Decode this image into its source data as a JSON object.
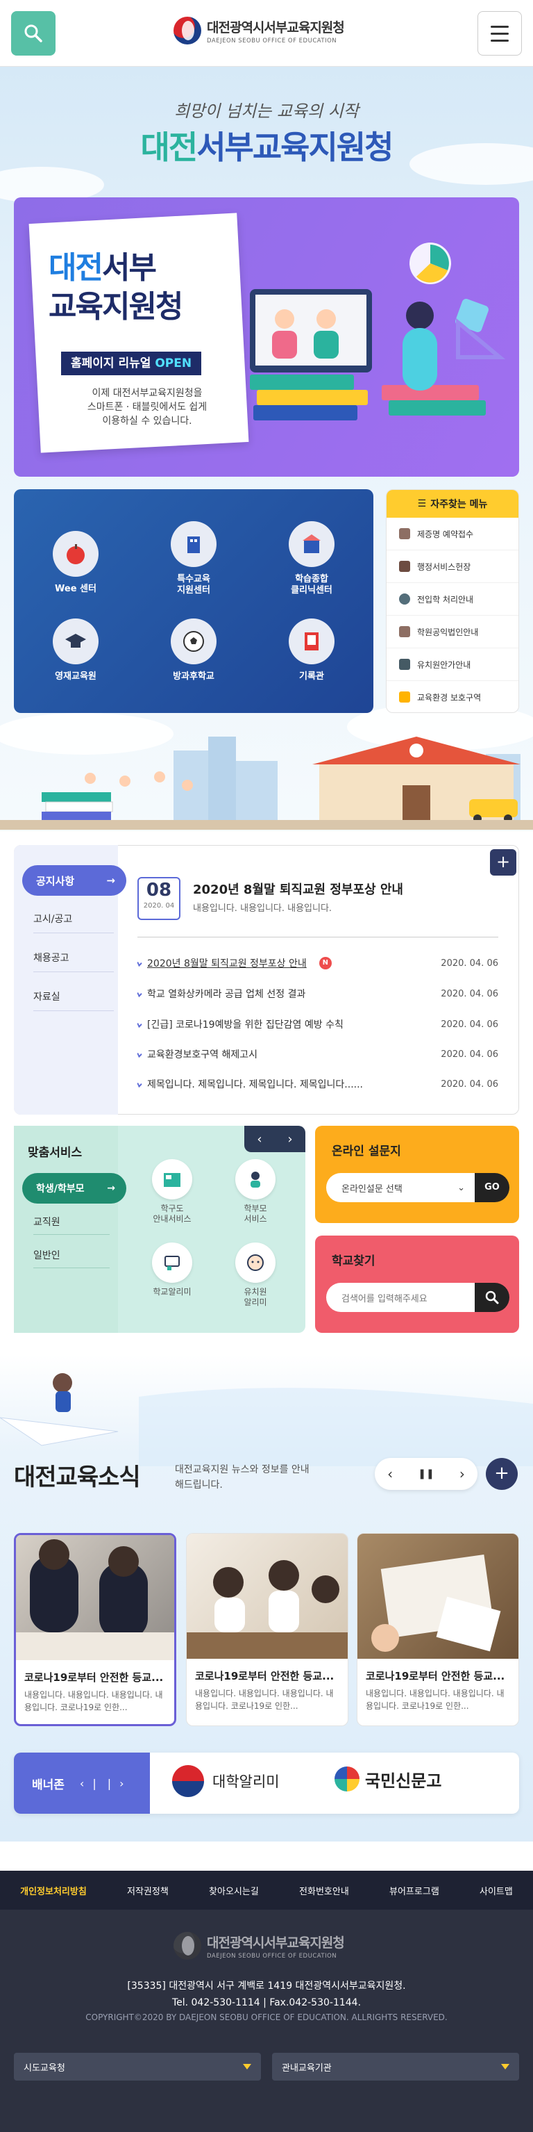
{
  "header": {
    "logo_ko": "대전광역시서부교육지원청",
    "logo_en": "DAEJEON SEOBU OFFICE OF EDUCATION"
  },
  "hero": {
    "slogan": "희망이 넘치는 교육의 시작",
    "title_part1": "대전",
    "title_part2": "서부교육지원청"
  },
  "slide": {
    "title_l1a": "대전",
    "title_l1b": "서부",
    "title_l2": "교육지원청",
    "badge": "홈페이지 리뉴얼",
    "badge_open": "OPEN",
    "desc_l1": "이제 대전서부교육지원청을",
    "desc_l2": "스마트폰 · 태블릿에서도 쉽게",
    "desc_l3": "이용하실 수 있습니다."
  },
  "quick_menu": [
    {
      "label": "Wee 센터",
      "icon": "apple-icon"
    },
    {
      "label": "특수교육\n지원센터",
      "icon": "building-icon"
    },
    {
      "label": "학습종합\n클리닉센터",
      "icon": "school-icon"
    },
    {
      "label": "영재교육원",
      "icon": "graduation-cap-icon"
    },
    {
      "label": "방과후학교",
      "icon": "soccer-ball-icon"
    },
    {
      "label": "기록관",
      "icon": "frame-icon"
    }
  ],
  "faq": {
    "title": "자주찾는 메뉴",
    "items": [
      {
        "label": "제증명 예약접수",
        "icon": "document-icon"
      },
      {
        "label": "행정서비스헌장",
        "icon": "gavel-icon"
      },
      {
        "label": "전입학 처리안내",
        "icon": "headset-icon"
      },
      {
        "label": "학원공익법인안내",
        "icon": "book-icon"
      },
      {
        "label": "유치원안가안내",
        "icon": "house-icon"
      },
      {
        "label": "교육환경 보호구역",
        "icon": "shield-icon"
      }
    ]
  },
  "notice": {
    "tabs": [
      "공지사항",
      "고시/공고",
      "채용공고",
      "자료실"
    ],
    "plus": "+",
    "featured": {
      "day": "08",
      "ym": "2020. 04",
      "title": "2020년 8월말 퇴직교원 정부포상 안내",
      "desc": "내용입니다. 내용입니다. 내용입니다."
    },
    "rows": [
      {
        "title": "2020년 8월말 퇴직교원 정부포상 안내",
        "date": "2020. 04. 06",
        "new": "N"
      },
      {
        "title": "학교 열화상카메라 공급 업체 선정 결과",
        "date": "2020. 04. 06"
      },
      {
        "title": "[긴급] 코로나19예방을 위한 집단감염 예방 수칙",
        "date": "2020. 04. 06"
      },
      {
        "title": "교육환경보호구역 해제고시",
        "date": "2020. 04. 06"
      },
      {
        "title": "제목입니다. 제목입니다. 제목입니다. 제목입니다......",
        "date": "2020. 04. 06"
      }
    ]
  },
  "service": {
    "title": "맞춤서비스",
    "tabs": [
      "학생/학부모",
      "교직원",
      "일반인"
    ],
    "items": [
      {
        "label": "학구도\n안내서비스",
        "icon": "map-icon"
      },
      {
        "label": "학부모\n서비스",
        "icon": "parent-icon"
      },
      {
        "label": "학교알리미",
        "icon": "megaphone-icon"
      },
      {
        "label": "유치원\n알리미",
        "icon": "child-face-icon"
      }
    ]
  },
  "survey": {
    "title": "온라인 설문지",
    "select": "온라인설문 선택",
    "go": "GO"
  },
  "school_find": {
    "title": "학교찾기",
    "placeholder": "검색어를 입력해주세요"
  },
  "news": {
    "title": "대전교육소식",
    "desc": "대전교육지원 뉴스와 정보를 안내해드립니다.",
    "plus": "+",
    "cards": [
      {
        "title": "코로나19로부터 안전한 등교...",
        "desc": "내용입니다. 내용입니다. 내용입니다. 내용입니다. 코로나19로 인한..."
      },
      {
        "title": "코로나19로부터 안전한 등교...",
        "desc": "내용입니다. 내용입니다. 내용입니다. 내용입니다. 코로나19로 인한..."
      },
      {
        "title": "코로나19로부터 안전한 등교...",
        "desc": "내용입니다. 내용입니다. 내용입니다. 내용입니다. 코로나19로 인한..."
      }
    ]
  },
  "banner_zone": {
    "title": "배너존",
    "banner1": "대학알리미",
    "banner2": "국민신문고"
  },
  "footer": {
    "nav": [
      "개인정보처리방침",
      "저작권정책",
      "찾아오시는길",
      "전화번호안내",
      "뷰어프로그램",
      "사이트맵"
    ],
    "address": "[35335] 대전광역시 서구 계백로 1419 대전광역시서부교육지원청.",
    "tel": "Tel. 042-530-1114 | Fax.042-530-1144.",
    "copyright": "COPYRIGHT©2020 BY DAEJEON SEOBU OFFICE OF EDUCATION. ALLRIGHTS RESERVED.",
    "select1": "시도교육청",
    "select2": "관내교육기관"
  },
  "colors": {
    "accent_green": "#57c0a6",
    "primary_blue": "#2d59b8",
    "purple": "#5c6ad8",
    "yellow": "#ffcc2e",
    "red": "#f05c6b",
    "orange": "#fdac1c"
  }
}
